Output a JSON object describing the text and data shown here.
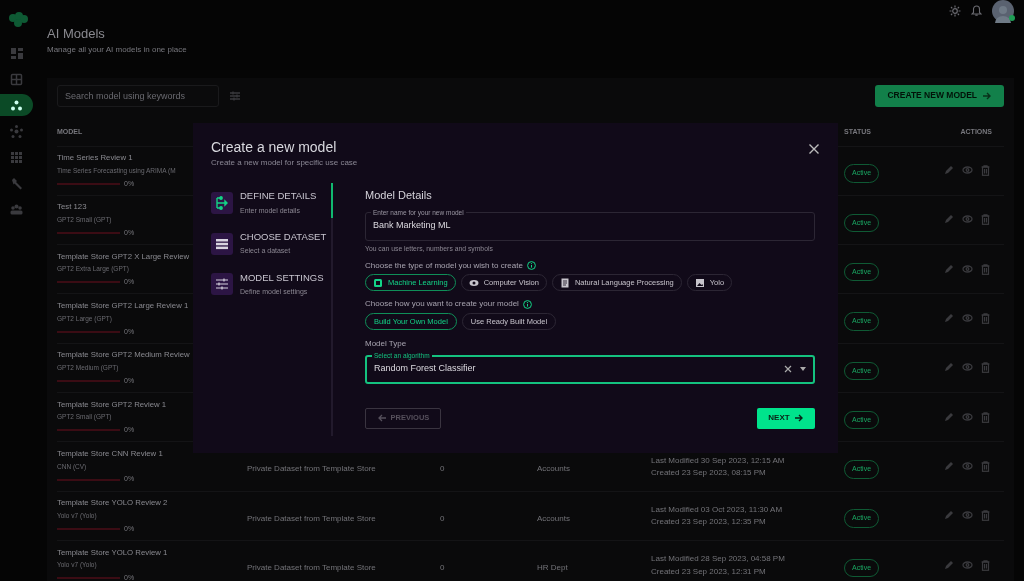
{
  "sidebar": {
    "items": [
      {
        "selected": false
      },
      {
        "selected": false
      },
      {
        "selected": true
      },
      {
        "selected": false
      },
      {
        "selected": false
      },
      {
        "selected": false
      },
      {
        "selected": false
      }
    ]
  },
  "header": {
    "title": "AI Models",
    "subtitle": "Manage all your AI models in one place"
  },
  "toolbar": {
    "search_placeholder": "Search model using keywords",
    "create_button": "CREATE NEW MODEL"
  },
  "table": {
    "columns": [
      "MODEL",
      "STATUS",
      "ACTIONS"
    ],
    "rows": [
      {
        "name": "Time Series Review 1",
        "type": "Time Series Forecasting using ARIMA (M",
        "level": 0,
        "percent": "0%",
        "status": "Active"
      },
      {
        "name": "Test 123",
        "type": "GPT2 Small (GPT)",
        "level": 0,
        "percent": "0%",
        "status": "Active"
      },
      {
        "name": "Template Store GPT2 X Large Review",
        "type": "GPT2 Extra Large (GPT)",
        "level": 0,
        "percent": "0%",
        "status": "Active"
      },
      {
        "name": "Template Store GPT2 Large Review 1",
        "type": "GPT2 Large (GPT)",
        "level": 0,
        "percent": "0%",
        "status": "Active"
      },
      {
        "name": "Template Store GPT2 Medium Review",
        "type": "GPT2 Medium (GPT)",
        "level": 0,
        "percent": "0%",
        "status": "Active"
      },
      {
        "name": "Template Store GPT2 Review 1",
        "type": "GPT2 Small (GPT)",
        "level": 0,
        "percent": "0%",
        "status": "Active"
      },
      {
        "name": "Template Store CNN Review 1",
        "type": "CNN (CV)",
        "level": 0,
        "percent": "0%",
        "dataset": "Private Dataset from Template Store",
        "count": "0",
        "department": "Accounts",
        "modified": "Last Modified 30 Sep 2023, 12:15 AM",
        "created": "Created 23 Sep 2023, 08:15 PM",
        "status": "Active"
      },
      {
        "name": "Template Store YOLO Review 2",
        "type": "Yolo v7 (Yolo)",
        "level": 0,
        "percent": "0%",
        "dataset": "Private Dataset from Template Store",
        "count": "0",
        "department": "Accounts",
        "modified": "Last Modified 03 Oct 2023, 11:30 AM",
        "created": "Created 23 Sep 2023, 12:35 PM",
        "status": "Active"
      },
      {
        "name": "Template Store YOLO Review 1",
        "type": "Yolo v7 (Yolo)",
        "level": 0,
        "percent": "0%",
        "dataset": "Private Dataset from Template Store",
        "count": "0",
        "department": "HR Dept",
        "modified": "Last Modified 28 Sep 2023, 04:58 PM",
        "created": "Created 23 Sep 2023, 12:31 PM",
        "status": "Active"
      }
    ]
  },
  "modal": {
    "title": "Create a new model",
    "subtitle": "Create a new model for specific use case",
    "steps": [
      {
        "title": "DEFINE DETAILS",
        "subtitle": "Enter model details",
        "selected": true
      },
      {
        "title": "CHOOSE DATASET",
        "subtitle": "Select a dataset",
        "selected": false
      },
      {
        "title": "MODEL SETTINGS",
        "subtitle": "Define model settings",
        "selected": false
      }
    ],
    "section_title": "Model Details",
    "name_field": {
      "label": "Enter name for your new model",
      "value": "Bank Marketing ML",
      "hint": "You can use letters, numbers and symbols"
    },
    "type_question": "Choose the type of model you wish to create",
    "model_types": [
      {
        "label": "Machine Learning",
        "selected": true
      },
      {
        "label": "Computer Vision",
        "selected": false
      },
      {
        "label": "Natural Language Processing",
        "selected": false
      },
      {
        "label": "Yolo",
        "selected": false
      }
    ],
    "method_question": "Choose how you want to create your model",
    "methods": [
      {
        "label": "Build Your Own Model",
        "selected": true
      },
      {
        "label": "Use Ready Built Model",
        "selected": false
      }
    ],
    "model_type_label": "Model Type",
    "algorithm_field": {
      "label": "Select an algorithm",
      "value": "Random Forest Classifier"
    },
    "previous_button": {
      "label": "PREVIOUS",
      "disabled": true
    },
    "next_button": {
      "label": "NEXT",
      "disabled": false
    }
  }
}
